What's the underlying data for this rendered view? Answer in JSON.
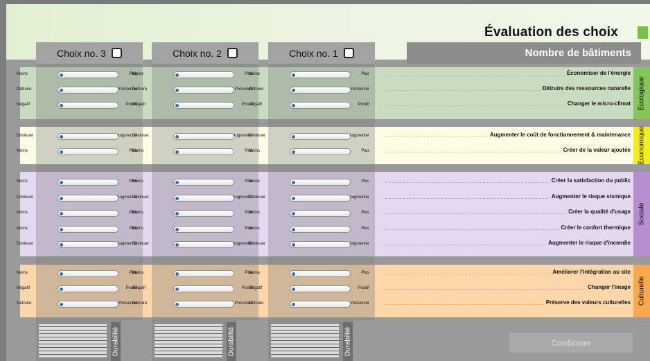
{
  "header": {
    "title": "Évaluation des choix",
    "buildings_label": "Nombre de bâtiments"
  },
  "choices": [
    {
      "label": "Choix no. 3"
    },
    {
      "label": "Choix no. 2"
    },
    {
      "label": "Choix no. 1"
    }
  ],
  "categories": [
    {
      "name": "Écologique",
      "colors": {
        "bg": "#c9dcc0",
        "tab": "#86c45c",
        "dash": "#a8c9a0"
      },
      "rows": [
        {
          "left": "Moins",
          "right": "Plus",
          "criterion": "Économiser de l'énergie"
        },
        {
          "left": "Détruire",
          "right": "Préserver",
          "criterion": "Détruire des ressources naturelle"
        },
        {
          "left": "Négatif",
          "right": "Positif",
          "criterion": "Changer le micro-climat"
        }
      ]
    },
    {
      "name": "Économique",
      "colors": {
        "bg": "#fcfde4",
        "tab": "#f2ee1a",
        "dash": "#e3d870"
      },
      "rows": [
        {
          "left": "Diminuer",
          "right": "Augmenter",
          "criterion": "Augmenter le coût de fonctionnement & maintenance"
        },
        {
          "left": "Moins",
          "right": "Plus",
          "criterion": "Créer de la valeur ajoutée"
        }
      ]
    },
    {
      "name": "Sociale",
      "colors": {
        "bg": "#e4d8f0",
        "tab": "#b58fd0",
        "dash": "#b9a4cf"
      },
      "rows": [
        {
          "left": "Moins",
          "right": "Plus",
          "criterion": "Créer la satisfaction du public"
        },
        {
          "left": "Diminuer",
          "right": "Augmenter",
          "criterion": "Augmenter le risque sismique"
        },
        {
          "left": "Moins",
          "right": "Plus",
          "criterion": "Créer la qualité d'usage"
        },
        {
          "left": "Moins",
          "right": "Plus",
          "criterion": "Créer le confort thermique"
        },
        {
          "left": "Diminuer",
          "right": "Augmenter",
          "criterion": "Augmenter le risque d'incendie"
        }
      ]
    },
    {
      "name": "Culturelle",
      "colors": {
        "bg": "#fdd6aa",
        "tab": "#f7a74e",
        "dash": "#f0b45a"
      },
      "rows": [
        {
          "left": "Moins",
          "right": "Plus",
          "criterion": "Améliorer l'intégration au site"
        },
        {
          "left": "Négatif",
          "right": "Positif",
          "criterion": "Changer l'image"
        },
        {
          "left": "Détruire",
          "right": "Préserver",
          "criterion": "Préserve des valeurs culturelles"
        }
      ]
    }
  ],
  "durability": {
    "label": "Durabilité"
  },
  "confirm": {
    "label": "Confirmer"
  }
}
